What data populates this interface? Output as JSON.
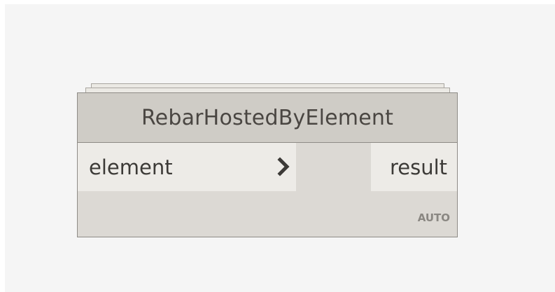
{
  "node": {
    "title": "RebarHostedByElement",
    "inputs": [
      {
        "label": "element"
      }
    ],
    "outputs": [
      {
        "label": "result"
      }
    ],
    "lacing": "AUTO"
  },
  "icons": {
    "input_port_arrow": "chevron-right-icon"
  },
  "colors": {
    "canvas_background": "#f5f5f5",
    "node_header": "#cfccc6",
    "node_body": "#dcd9d4",
    "port_background": "#edebe7",
    "node_border": "#8e8b86"
  }
}
